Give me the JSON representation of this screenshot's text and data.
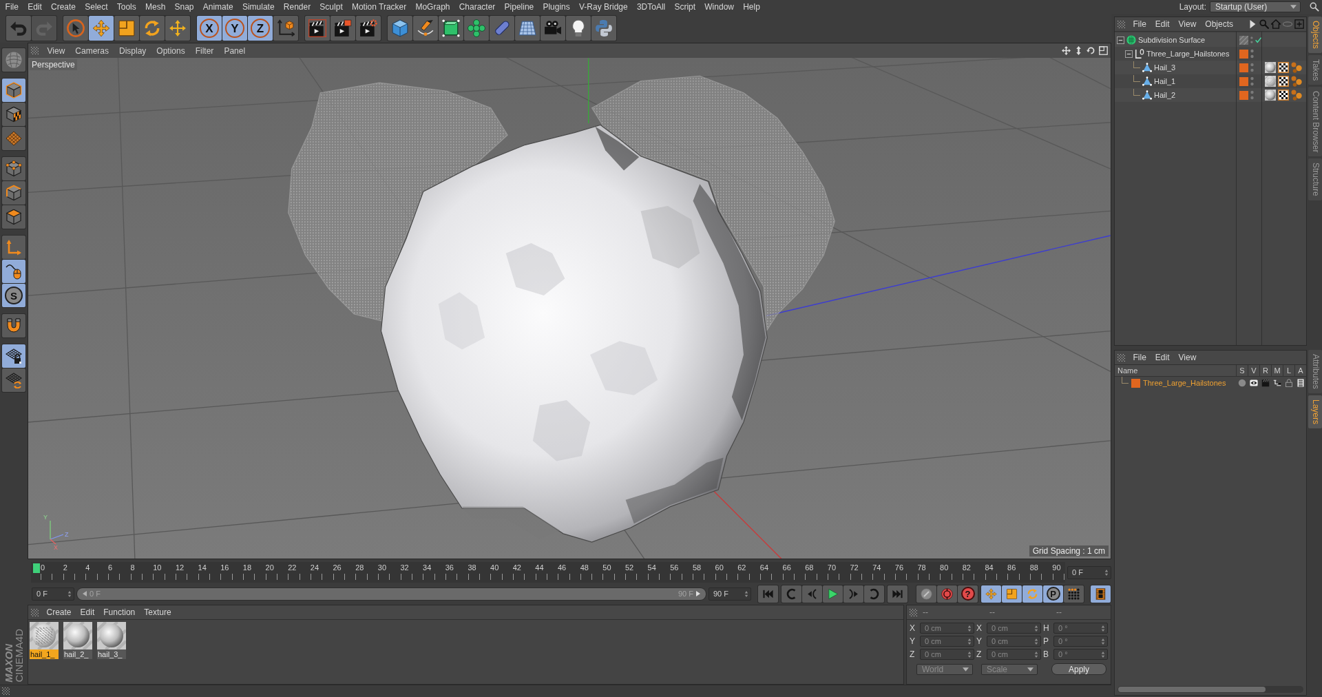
{
  "menu_bar": {
    "items": [
      "File",
      "Edit",
      "Create",
      "Select",
      "Tools",
      "Mesh",
      "Snap",
      "Animate",
      "Simulate",
      "Render",
      "Sculpt",
      "Motion Tracker",
      "MoGraph",
      "Character",
      "Pipeline",
      "Plugins",
      "V-Ray Bridge",
      "3DToAll",
      "Script",
      "Window",
      "Help"
    ],
    "layout_label": "Layout:",
    "layout_value": "Startup (User)"
  },
  "toolbar": [
    [
      {
        "selected": false,
        "disabled": false
      },
      {
        "selected": false,
        "disabled": true
      }
    ],
    [
      {
        "selected": false,
        "disabled": false
      },
      {
        "selected": true,
        "disabled": false
      },
      {
        "selected": false,
        "disabled": false
      },
      {
        "selected": false,
        "disabled": false
      },
      {
        "selected": false,
        "disabled": false
      }
    ],
    [
      {
        "label": "X",
        "selected": true,
        "disabled": false
      },
      {
        "label": "Y",
        "selected": true,
        "disabled": false
      },
      {
        "label": "Z",
        "selected": true,
        "disabled": false
      },
      {
        "selected": false,
        "disabled": false
      }
    ],
    [
      {
        "selected": false,
        "disabled": false
      },
      {
        "selected": false,
        "disabled": false
      },
      {
        "selected": false,
        "disabled": false
      }
    ],
    [
      {
        "selected": false,
        "disabled": false
      },
      {
        "selected": false,
        "disabled": false
      },
      {
        "selected": false,
        "disabled": false
      },
      {
        "selected": false,
        "disabled": false
      },
      {
        "selected": false,
        "disabled": false
      },
      {
        "selected": false,
        "disabled": false
      },
      {
        "selected": false,
        "disabled": false
      },
      {
        "selected": false,
        "disabled": false
      },
      {
        "selected": false,
        "disabled": false
      }
    ]
  ],
  "left_toolbar": [
    [
      {
        "selected": false
      }
    ],
    [
      {
        "selected": true
      },
      {
        "selected": false
      },
      {
        "selected": false
      }
    ],
    [
      {
        "selected": false
      },
      {
        "selected": false
      },
      {
        "selected": false
      }
    ],
    [
      {
        "selected": false
      },
      {
        "selected": true
      },
      {
        "label": "S",
        "selected": true
      }
    ],
    [
      {
        "selected": false
      }
    ],
    [
      {
        "selected": true
      },
      {
        "selected": false
      }
    ]
  ],
  "viewport": {
    "menu": [
      "View",
      "Cameras",
      "Display",
      "Options",
      "Filter",
      "Panel"
    ],
    "camera": "Perspective",
    "grid_spacing": "Grid Spacing : 1 cm",
    "axis_labels": [
      "Y",
      "Z",
      "X"
    ]
  },
  "timeline": {
    "ruler": [
      "0",
      "2",
      "4",
      "6",
      "8",
      "10",
      "12",
      "14",
      "16",
      "18",
      "20",
      "22",
      "24",
      "26",
      "28",
      "30",
      "32",
      "34",
      "36",
      "38",
      "40",
      "42",
      "44",
      "46",
      "48",
      "50",
      "52",
      "54",
      "56",
      "58",
      "60",
      "62",
      "64",
      "66",
      "68",
      "70",
      "72",
      "74",
      "76",
      "78",
      "80",
      "82",
      "84",
      "86",
      "88",
      "90"
    ],
    "playhead": {
      "level": 0
    },
    "frame": "0 F"
  },
  "transport": {
    "start": "0 F",
    "range": {
      "level": 1,
      "start": "0 F",
      "end": "90 F"
    },
    "end": "90 F",
    "buttons": [
      [
        {
          "selected": false
        }
      ],
      [
        {
          "selected": false
        },
        {
          "selected": false
        },
        {
          "selected": false
        },
        {
          "selected": false
        },
        {
          "selected": false
        }
      ],
      [
        {
          "selected": false
        }
      ],
      [
        {
          "selected": false
        },
        {
          "selected": false
        },
        {
          "label": "?",
          "selected": false
        }
      ],
      [
        {
          "selected": true
        },
        {
          "selected": true
        },
        {
          "selected": true
        },
        {
          "label": "P",
          "selected": true
        },
        {
          "selected": false
        }
      ],
      [
        {
          "selected": true
        }
      ]
    ]
  },
  "material_manager": {
    "menu": [
      "Create",
      "Edit",
      "Function",
      "Texture"
    ],
    "materials": [
      {
        "name": "hail_1_",
        "kind": "rough",
        "selected": true
      },
      {
        "name": "hail_2_",
        "kind": "smooth",
        "selected": false
      },
      {
        "name": "hail_3_",
        "kind": "smooth",
        "selected": false
      }
    ]
  },
  "coordinates": {
    "headers": [
      "--",
      "--",
      "--"
    ],
    "rows": [
      {
        "position_axis": "X",
        "position": "0 cm",
        "size_axis": "X",
        "size": "0 cm",
        "rotation_axis": "H",
        "rotation": "0 °"
      },
      {
        "position_axis": "Y",
        "position": "0 cm",
        "size_axis": "Y",
        "size": "0 cm",
        "rotation_axis": "P",
        "rotation": "0 °"
      },
      {
        "position_axis": "Z",
        "position": "0 cm",
        "size_axis": "Z",
        "size": "0 cm",
        "rotation_axis": "B",
        "rotation": "0 °"
      }
    ],
    "mode": "World",
    "transform": "Scale",
    "apply": "Apply"
  },
  "logo": {
    "brand": "MAXON",
    "product": "CINEMA4D"
  },
  "object_manager": {
    "menu": [
      "File",
      "Edit",
      "View",
      "Objects"
    ],
    "objects": [
      {
        "name": "Subdivision Surface",
        "kind": "subdivision",
        "expanded": true,
        "enabled": true,
        "children": [
          {
            "name": "Three_Large_Hailstones",
            "kind": "null",
            "expanded": true,
            "color": "#e0661f",
            "children": [
              {
                "name": "Hail_3",
                "kind": "polygon",
                "color": "#e0661f",
                "tags": [
                  {
                    "kind": "smoothmaterial"
                  },
                  {
                    "kind": "uvw"
                  },
                  {
                    "kind": "vertex"
                  }
                ]
              },
              {
                "name": "Hail_1",
                "kind": "polygon",
                "color": "#e0661f",
                "tags": [
                  {
                    "kind": "roughmaterial"
                  },
                  {
                    "kind": "uvw"
                  },
                  {
                    "kind": "vertex"
                  }
                ]
              },
              {
                "name": "Hail_2",
                "kind": "polygon",
                "color": "#e0661f",
                "tags": [
                  {
                    "kind": "smoothmaterial"
                  },
                  {
                    "kind": "uvw"
                  },
                  {
                    "kind": "vertex"
                  }
                ]
              }
            ]
          }
        ]
      }
    ]
  },
  "side_tabs": [
    {
      "label": "Objects",
      "selected": true
    },
    {
      "label": "Takes",
      "selected": false
    },
    {
      "label": "Content Browser",
      "selected": false
    },
    {
      "label": "Structure",
      "selected": false
    }
  ],
  "layer_manager": {
    "menu": [
      "File",
      "Edit",
      "View"
    ],
    "columns": [
      "Name",
      "S",
      "V",
      "R",
      "M",
      "L",
      "A"
    ],
    "layers": [
      {
        "name": "Three_Large_Hailstones",
        "color": "#e0661f",
        "selected": true
      }
    ]
  },
  "side_tabs_lower": [
    {
      "label": "Attributes",
      "selected": false
    },
    {
      "label": "Layers",
      "selected": true
    }
  ]
}
